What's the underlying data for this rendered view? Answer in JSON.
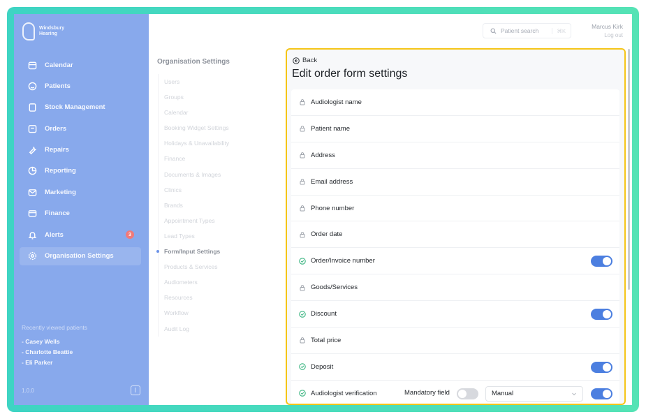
{
  "sidebar": {
    "brand_line1": "Windsbury",
    "brand_line2": "Hearing",
    "items": [
      {
        "label": "Calendar"
      },
      {
        "label": "Patients"
      },
      {
        "label": "Stock Management"
      },
      {
        "label": "Orders"
      },
      {
        "label": "Repairs"
      },
      {
        "label": "Reporting"
      },
      {
        "label": "Marketing"
      },
      {
        "label": "Finance"
      },
      {
        "label": "Alerts",
        "badge": "3"
      },
      {
        "label": "Organisation Settings"
      }
    ],
    "recent_title": "Recently viewed patients",
    "recent": [
      "- Casey Wells",
      "- Charlotte Beattie",
      "- Eli Parker"
    ],
    "version": "1.0.0"
  },
  "header": {
    "search_placeholder": "Patient search",
    "search_shortcut": "⌘K",
    "user_name": "Marcus Kirk",
    "logout": "Log out"
  },
  "settings_menu": {
    "title": "Organisation Settings",
    "items": [
      "Users",
      "Groups",
      "Calendar",
      "Booking Widget Settings",
      "Holidays & Unavailability",
      "Finance",
      "Documents & Images",
      "Clinics",
      "Brands",
      "Appointment Types",
      "Lead Types",
      "Form/Input Settings",
      "Products & Services",
      "Audiometers",
      "Resources",
      "Workflow",
      "Audit Log"
    ],
    "active": "Form/Input Settings"
  },
  "main": {
    "back_label": "Back",
    "title": "Edit order form settings",
    "rows": [
      {
        "label": "Audiologist name",
        "status": "locked"
      },
      {
        "label": "Patient name",
        "status": "locked"
      },
      {
        "label": "Address",
        "status": "locked"
      },
      {
        "label": "Email address",
        "status": "locked"
      },
      {
        "label": "Phone number",
        "status": "locked"
      },
      {
        "label": "Order date",
        "status": "locked"
      },
      {
        "label": "Order/Invoice number",
        "status": "enabled",
        "toggle": true
      },
      {
        "label": "Goods/Services",
        "status": "locked"
      },
      {
        "label": "Discount",
        "status": "enabled",
        "toggle": true
      },
      {
        "label": "Total price",
        "status": "locked"
      },
      {
        "label": "Deposit",
        "status": "enabled",
        "toggle": true
      },
      {
        "label": "Audiologist verification",
        "status": "enabled",
        "toggle": true,
        "mandatory_label": "Mandatory field",
        "mandatory": false,
        "select_value": "Manual"
      }
    ]
  },
  "colors": {
    "sidebar_bg": "#88a9ec",
    "accent": "#4c7fe0",
    "highlight_border": "#f5c518",
    "enabled_icon": "#36b37e",
    "frame": "#3ed4c3"
  },
  "icons": {
    "locked": "lock-icon",
    "enabled": "check-circle-icon"
  }
}
